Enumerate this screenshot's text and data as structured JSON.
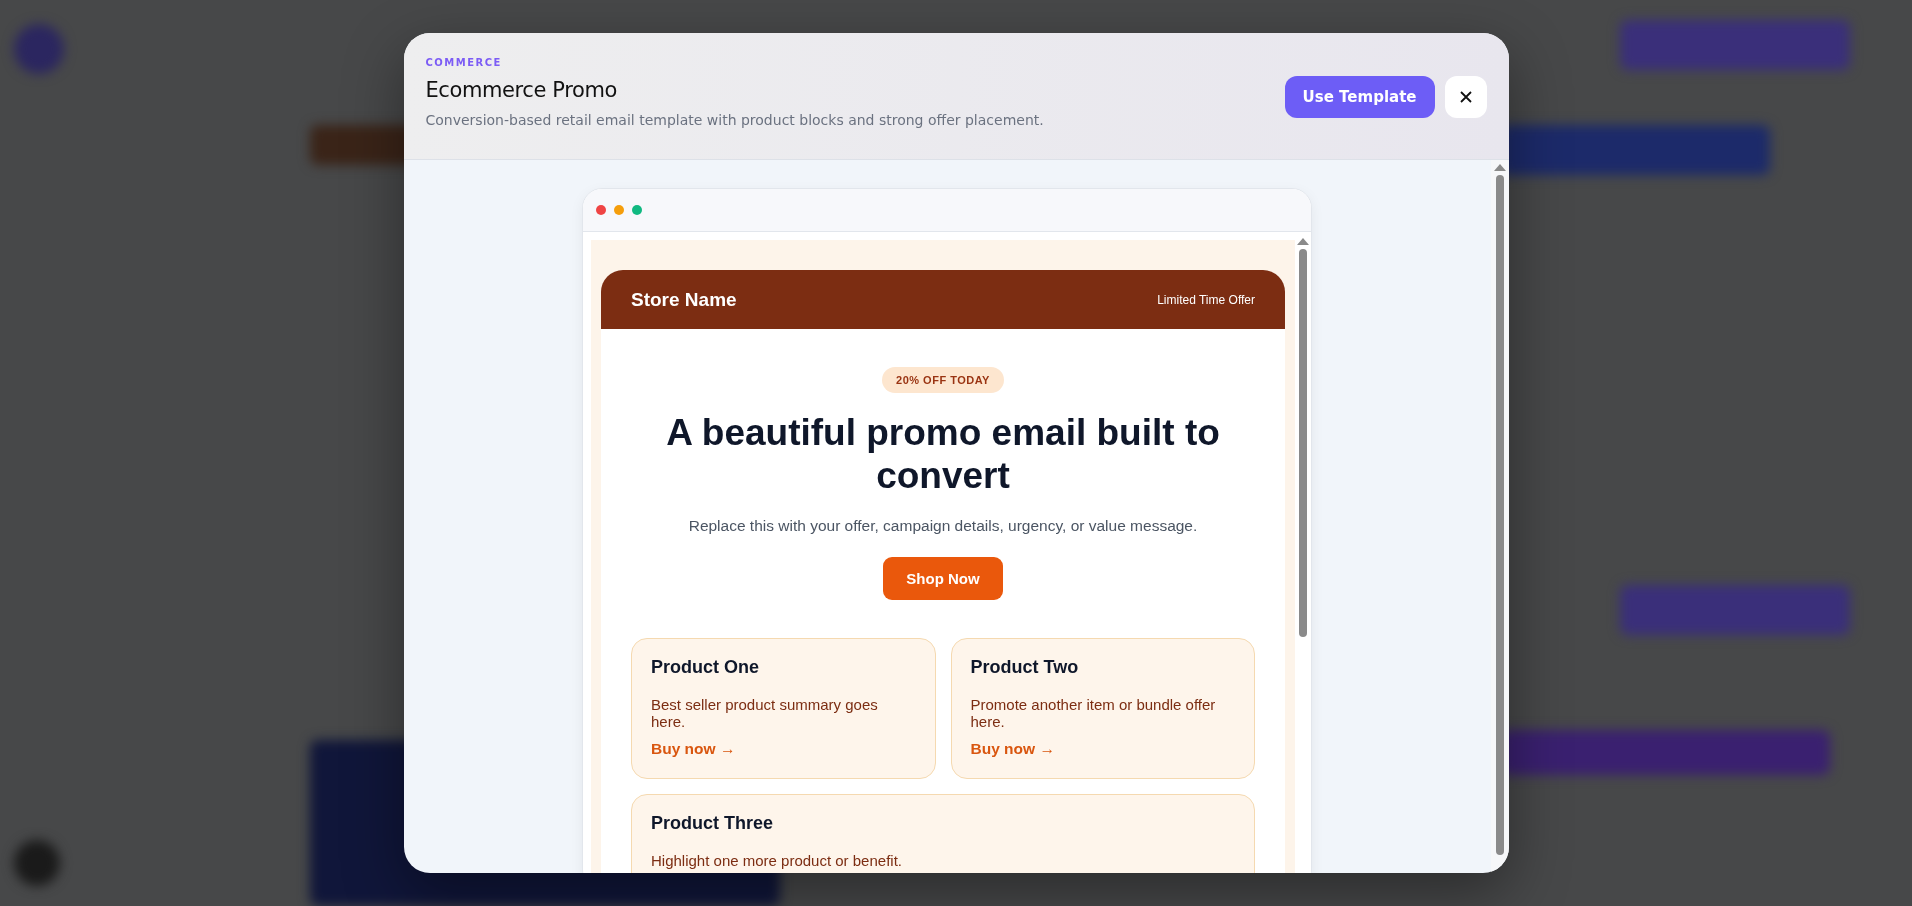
{
  "modal": {
    "category": "COMMERCE",
    "title": "Ecommerce Promo",
    "description": "Conversion-based retail email template with product blocks and strong offer placement.",
    "primary_button": "Use Template"
  },
  "email": {
    "store_name": "Store Name",
    "header_tag": "Limited Time Offer",
    "badge": "20% OFF TODAY",
    "headline": "A beautiful promo email built to convert",
    "message": "Replace this with your offer, campaign details, urgency, or value message.",
    "cta": "Shop Now",
    "products": [
      {
        "name": "Product One",
        "description": "Best seller product summary goes here.",
        "link": "Buy now →"
      },
      {
        "name": "Product Two",
        "description": "Promote another item or bundle offer here.",
        "link": "Buy now →"
      },
      {
        "name": "Product Three",
        "description": "Highlight one more product or benefit."
      }
    ]
  }
}
